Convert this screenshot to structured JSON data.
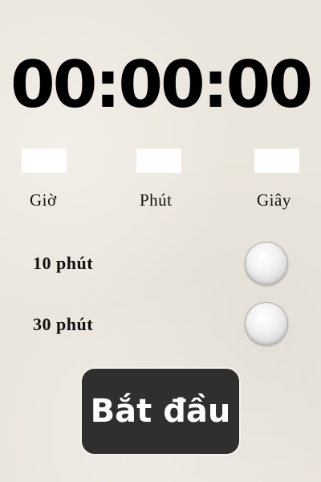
{
  "timer": {
    "display": "00:00:00"
  },
  "fields": {
    "hours": {
      "label": "Giờ",
      "value": ""
    },
    "minutes": {
      "label": "Phút",
      "value": ""
    },
    "seconds": {
      "label": "Giây",
      "value": ""
    }
  },
  "presets": [
    {
      "label": "10 phút",
      "selected": false
    },
    {
      "label": "30 phút",
      "selected": false
    }
  ],
  "start_button": {
    "label": "Bắt đầu"
  },
  "colors": {
    "background": "#ebe6dd",
    "button_bg": "#2f2f2f",
    "button_text": "#ffffff",
    "text": "#000000"
  }
}
